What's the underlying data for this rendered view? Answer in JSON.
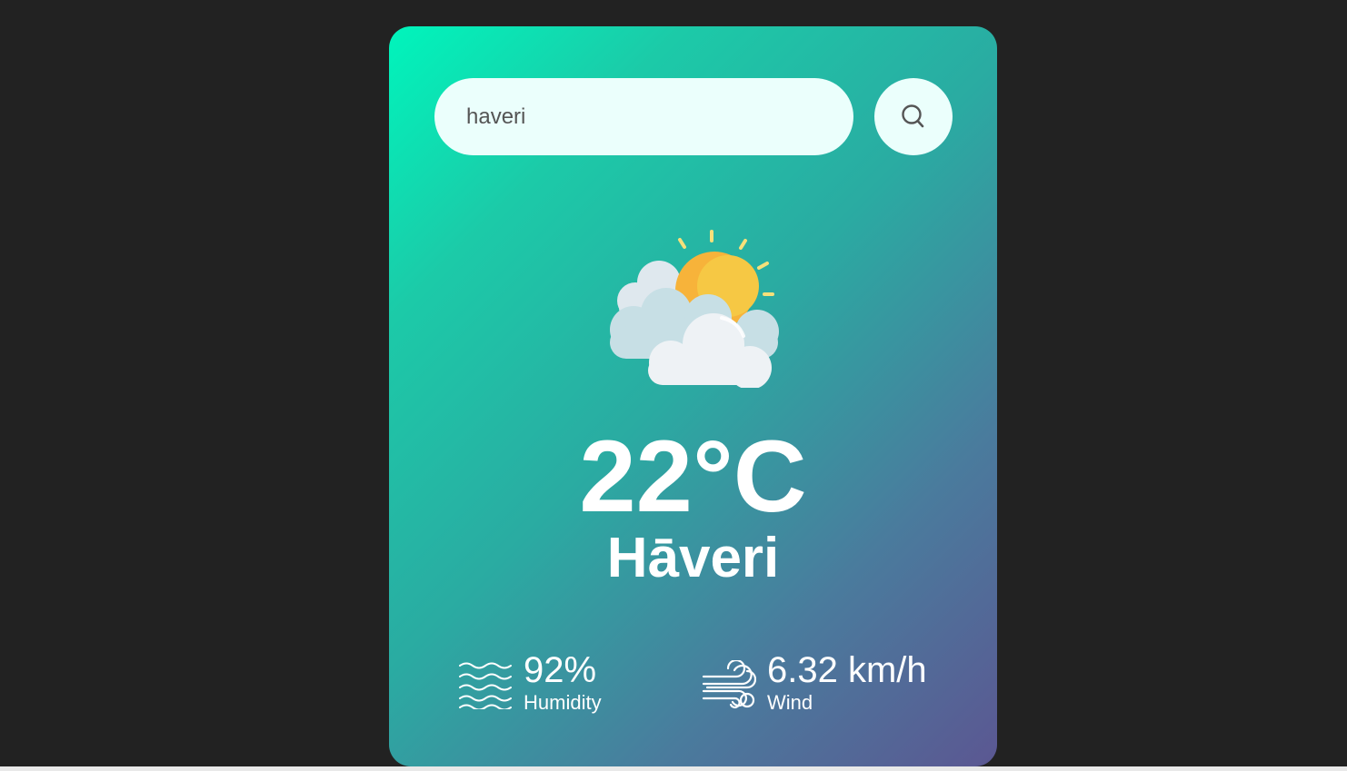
{
  "search": {
    "value": "haveri",
    "button_icon": "search-icon"
  },
  "weather": {
    "icon": "partly-cloudy-icon",
    "temperature": "22°C",
    "city": "Hāveri"
  },
  "details": {
    "humidity": {
      "icon": "humidity-waves-icon",
      "value": "92%",
      "label": "Humidity"
    },
    "wind": {
      "icon": "wind-icon",
      "value": "6.32 km/h",
      "label": "Wind"
    }
  },
  "colors": {
    "page_background": "#222222",
    "card_gradient_start": "#00f5bc",
    "card_gradient_end": "#5b5792",
    "input_background": "#ebfffc",
    "text": "#ffffff"
  }
}
